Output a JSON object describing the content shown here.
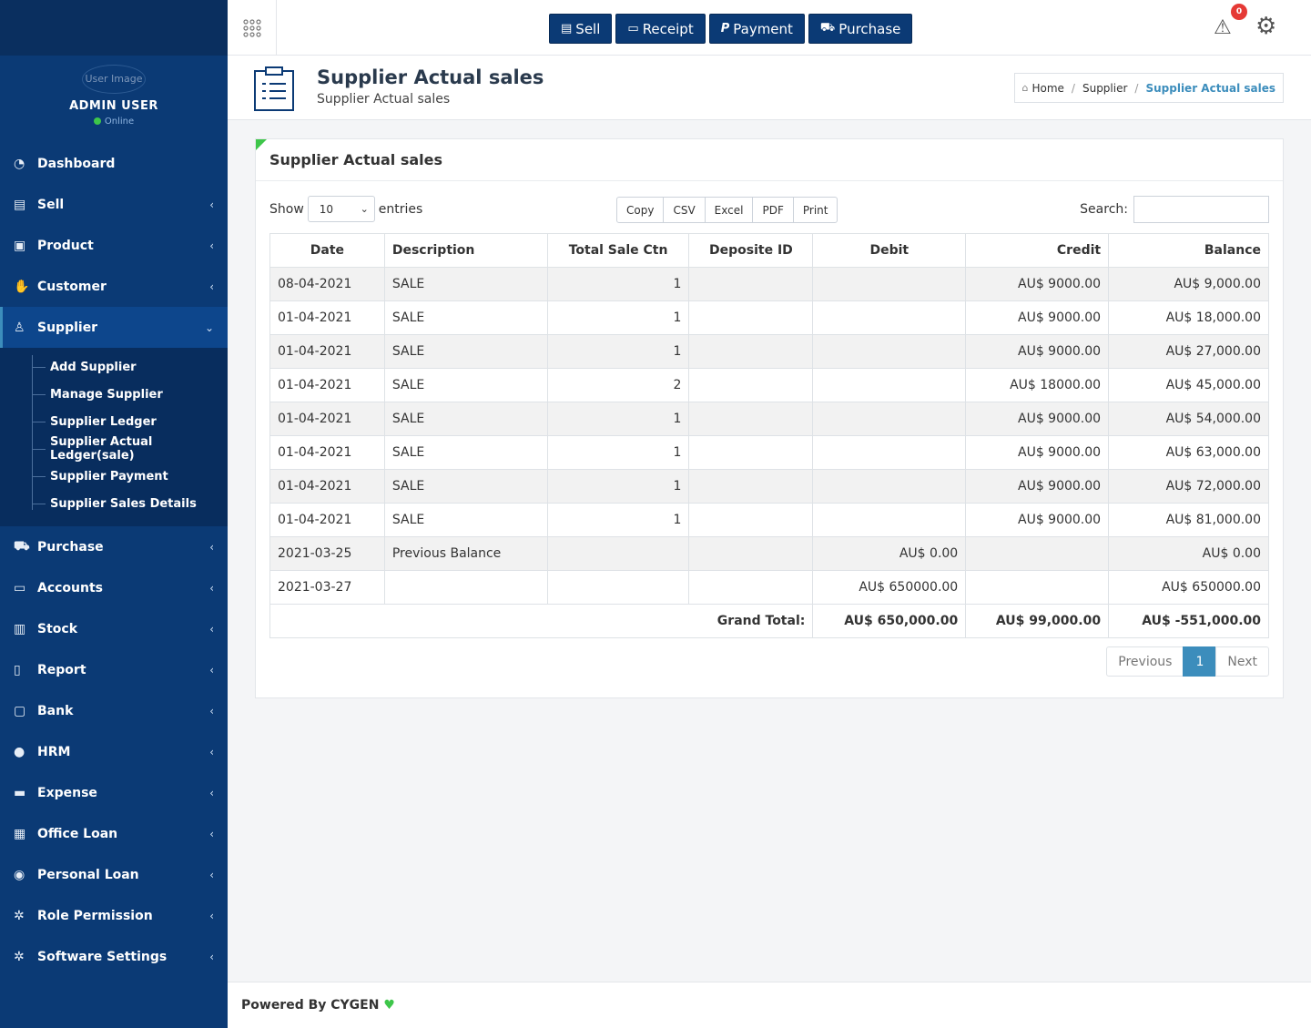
{
  "user": {
    "avatar_alt": "User Image",
    "name": "ADMIN USER",
    "status": "Online"
  },
  "sidebar": {
    "items": [
      {
        "label": "Dashboard",
        "icon": "dashboard-icon"
      },
      {
        "label": "Sell",
        "icon": "sell-icon"
      },
      {
        "label": "Product",
        "icon": "product-icon"
      },
      {
        "label": "Customer",
        "icon": "handshake-icon"
      },
      {
        "label": "Supplier",
        "icon": "user-icon"
      },
      {
        "label": "Purchase",
        "icon": "cart-icon"
      },
      {
        "label": "Accounts",
        "icon": "money-icon"
      },
      {
        "label": "Stock",
        "icon": "chart-icon"
      },
      {
        "label": "Report",
        "icon": "book-icon"
      },
      {
        "label": "Bank",
        "icon": "briefcase-icon"
      },
      {
        "label": "HRM",
        "icon": "person-icon"
      },
      {
        "label": "Expense",
        "icon": "credit-card-icon"
      },
      {
        "label": "Office Loan",
        "icon": "bank-icon"
      },
      {
        "label": "Personal Loan",
        "icon": "user-circle-icon"
      },
      {
        "label": "Role Permission",
        "icon": "gear-icon"
      },
      {
        "label": "Software Settings",
        "icon": "gear-icon"
      }
    ],
    "supplier_sub": [
      "Add Supplier",
      "Manage Supplier",
      "Supplier Ledger",
      "Supplier Actual Ledger(sale)",
      "Supplier Payment",
      "Supplier Sales Details"
    ]
  },
  "topbar": {
    "buttons": [
      "Sell",
      "Receipt",
      "Payment",
      "Purchase"
    ],
    "alert_count": "0"
  },
  "header": {
    "title": "Supplier Actual sales",
    "subtitle": "Supplier Actual sales",
    "breadcrumb": [
      "Home",
      "Supplier",
      "Supplier Actual sales"
    ]
  },
  "panel": {
    "title": "Supplier Actual sales",
    "show_label": "Show",
    "entries_value": "10",
    "entries_label": "entries",
    "export_buttons": [
      "Copy",
      "CSV",
      "Excel",
      "PDF",
      "Print"
    ],
    "search_label": "Search:"
  },
  "table": {
    "headers": [
      "Date",
      "Description",
      "Total Sale Ctn",
      "Deposite ID",
      "Debit",
      "Credit",
      "Balance"
    ],
    "rows": [
      [
        "08-04-2021",
        "SALE",
        "1",
        "",
        "",
        "AU$ 9000.00",
        "AU$ 9,000.00"
      ],
      [
        "01-04-2021",
        "SALE",
        "1",
        "",
        "",
        "AU$ 9000.00",
        "AU$ 18,000.00"
      ],
      [
        "01-04-2021",
        "SALE",
        "1",
        "",
        "",
        "AU$ 9000.00",
        "AU$ 27,000.00"
      ],
      [
        "01-04-2021",
        "SALE",
        "2",
        "",
        "",
        "AU$ 18000.00",
        "AU$ 45,000.00"
      ],
      [
        "01-04-2021",
        "SALE",
        "1",
        "",
        "",
        "AU$ 9000.00",
        "AU$ 54,000.00"
      ],
      [
        "01-04-2021",
        "SALE",
        "1",
        "",
        "",
        "AU$ 9000.00",
        "AU$ 63,000.00"
      ],
      [
        "01-04-2021",
        "SALE",
        "1",
        "",
        "",
        "AU$ 9000.00",
        "AU$ 72,000.00"
      ],
      [
        "01-04-2021",
        "SALE",
        "1",
        "",
        "",
        "AU$ 9000.00",
        "AU$ 81,000.00"
      ],
      [
        "2021-03-25",
        "Previous Balance",
        "",
        "",
        "AU$ 0.00",
        "",
        "AU$ 0.00"
      ],
      [
        "2021-03-27",
        "",
        "",
        "",
        "AU$ 650000.00",
        "",
        "AU$ 650000.00"
      ]
    ],
    "footer": {
      "label": "Grand Total:",
      "debit": "AU$ 650,000.00",
      "credit": "AU$ 99,000.00",
      "balance": "AU$ -551,000.00"
    }
  },
  "pagination": {
    "previous": "Previous",
    "current": "1",
    "next": "Next"
  },
  "footer": {
    "text": "Powered By CYGEN"
  },
  "colors": {
    "sidebar": "#0b3a75",
    "accent": "#3c8dbc",
    "green": "#3ec64a",
    "badge": "#e53935"
  }
}
